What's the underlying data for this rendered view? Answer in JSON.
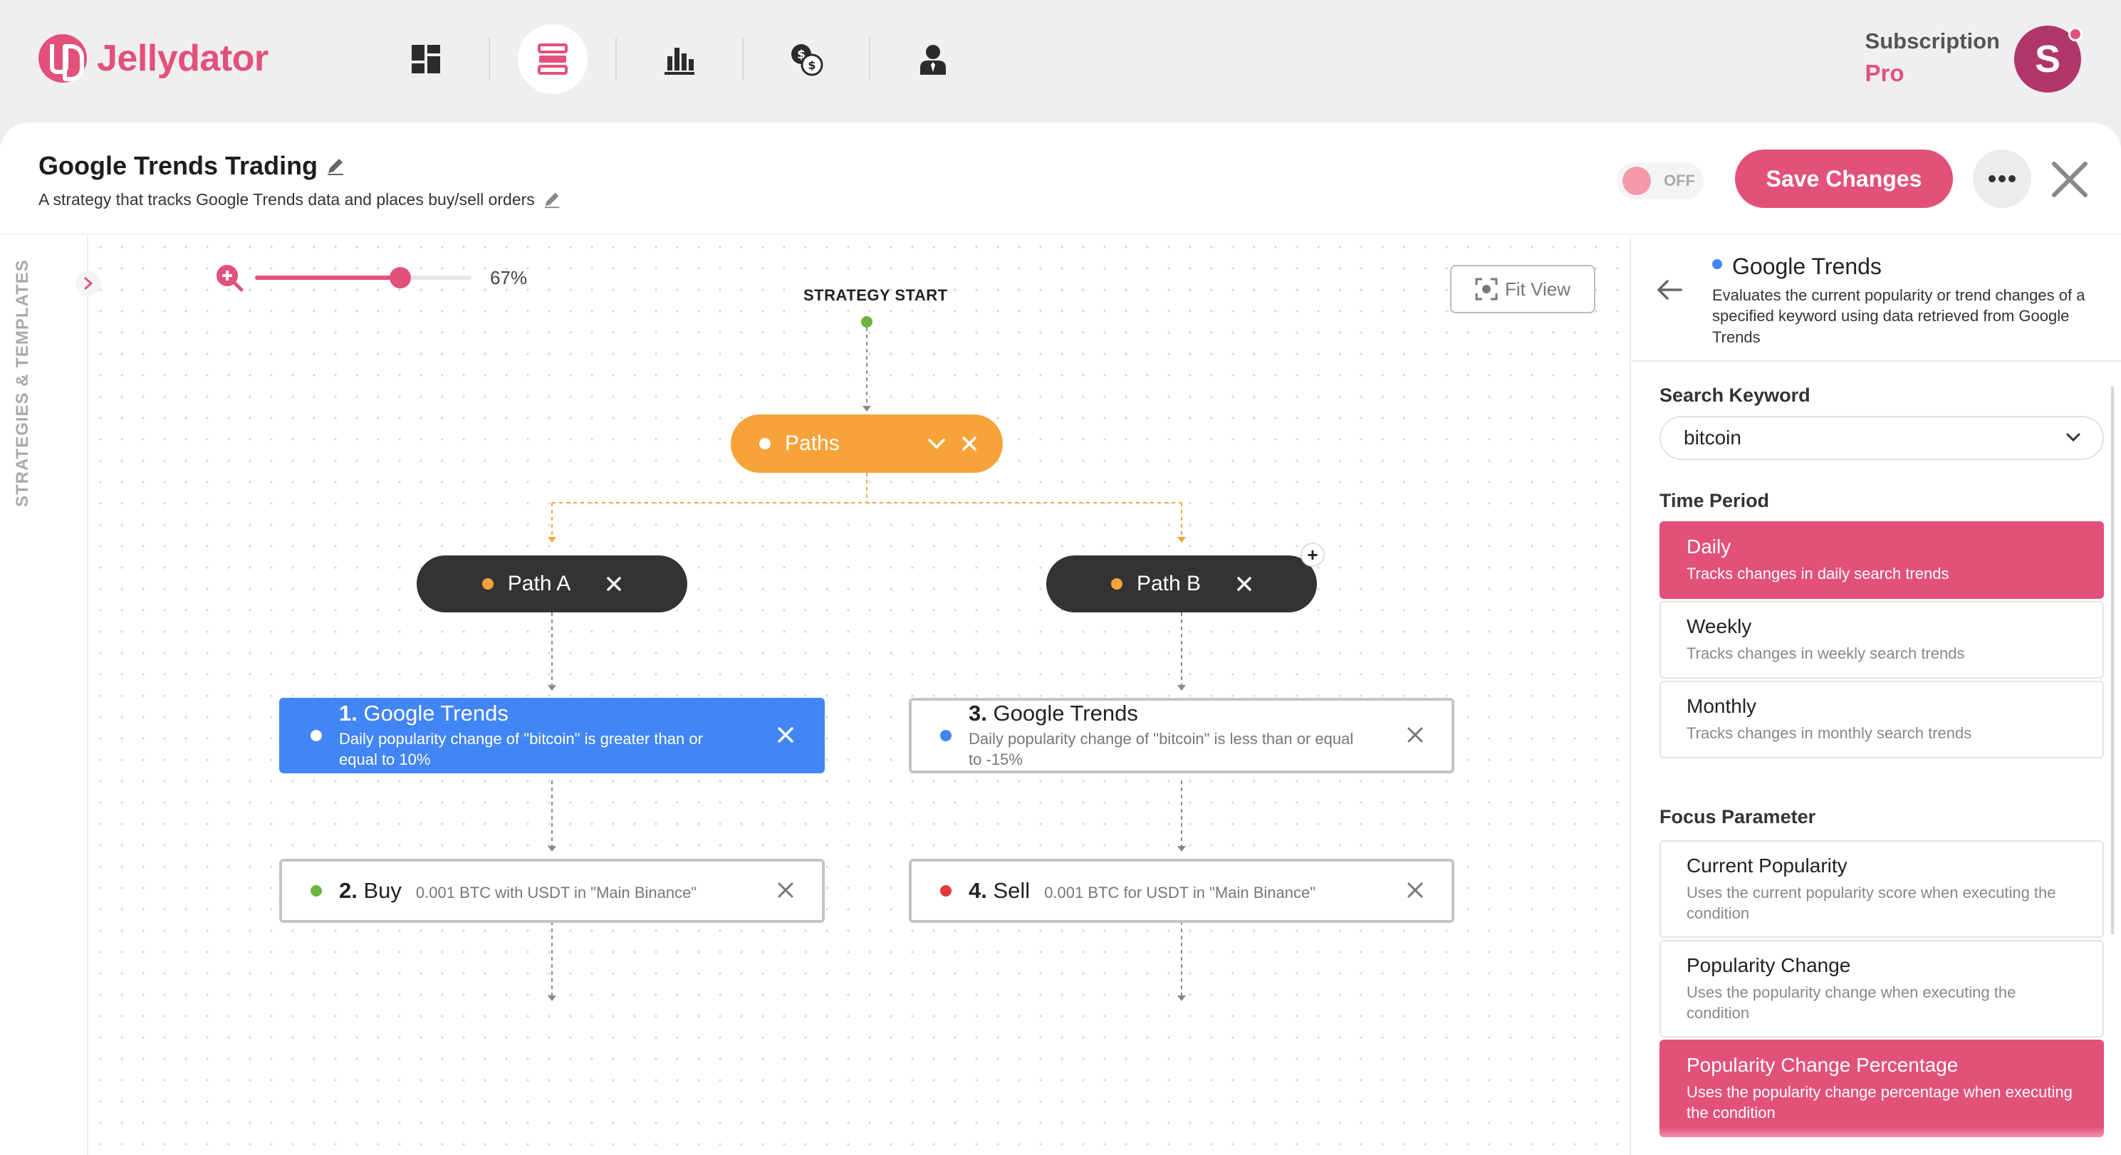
{
  "app": {
    "name": "Jellydator"
  },
  "nav": {
    "items": [
      "dashboard",
      "strategies",
      "analytics",
      "exchanges",
      "account"
    ],
    "active": "strategies"
  },
  "subscription": {
    "label": "Subscription",
    "plan": "Pro"
  },
  "user": {
    "avatar_letter": "S"
  },
  "strategy": {
    "title": "Google Trends Trading",
    "description": "A strategy that tracks Google Trends data and places buy/sell orders"
  },
  "toolbar": {
    "toggle_label": "OFF",
    "save_label": "Save Changes"
  },
  "sidebar": {
    "label": "STRATEGIES & TEMPLATES"
  },
  "canvas": {
    "zoom_level": 67,
    "zoom_label": "67%",
    "fit_view_label": "Fit View",
    "start_label": "STRATEGY START",
    "paths_label": "Paths",
    "path_a_label": "Path A",
    "path_b_label": "Path B",
    "nodes": [
      {
        "num": "1.",
        "title": "Google Trends",
        "sub": "Daily popularity change of \"bitcoin\" is greater than or equal to 10%"
      },
      {
        "num": "2.",
        "title": "Buy",
        "sub": "0.001 BTC with USDT in \"Main Binance\""
      },
      {
        "num": "3.",
        "title": "Google Trends",
        "sub": "Daily popularity change of \"bitcoin\" is less than or equal to -15%"
      },
      {
        "num": "4.",
        "title": "Sell",
        "sub": "0.001 BTC for USDT in \"Main Binance\""
      }
    ]
  },
  "panel": {
    "title": "Google Trends",
    "description": "Evaluates the current popularity or trend changes of a specified keyword using data retrieved from Google Trends",
    "keyword_label": "Search Keyword",
    "keyword_value": "bitcoin",
    "period_label": "Time Period",
    "periods": [
      {
        "title": "Daily",
        "desc": "Tracks changes in daily search trends"
      },
      {
        "title": "Weekly",
        "desc": "Tracks changes in weekly search trends"
      },
      {
        "title": "Monthly",
        "desc": "Tracks changes in monthly search trends"
      }
    ],
    "selected_period": "Daily",
    "focus_label": "Focus Parameter",
    "focus": [
      {
        "title": "Current Popularity",
        "desc": "Uses the current popularity score when executing the condition"
      },
      {
        "title": "Popularity Change",
        "desc": "Uses the popularity change when executing the condition"
      },
      {
        "title": "Popularity Change Percentage",
        "desc": "Uses the popularity change percentage when executing the condition"
      }
    ],
    "selected_focus": "Popularity Change Percentage"
  },
  "colors": {
    "brand": "#e2517a",
    "paths": "#f7a33a",
    "selected_node": "#4285f4",
    "path_pill": "#333333",
    "buy_dot": "#6db33f",
    "sell_dot": "#e53935",
    "start_dot": "#6db33f"
  }
}
